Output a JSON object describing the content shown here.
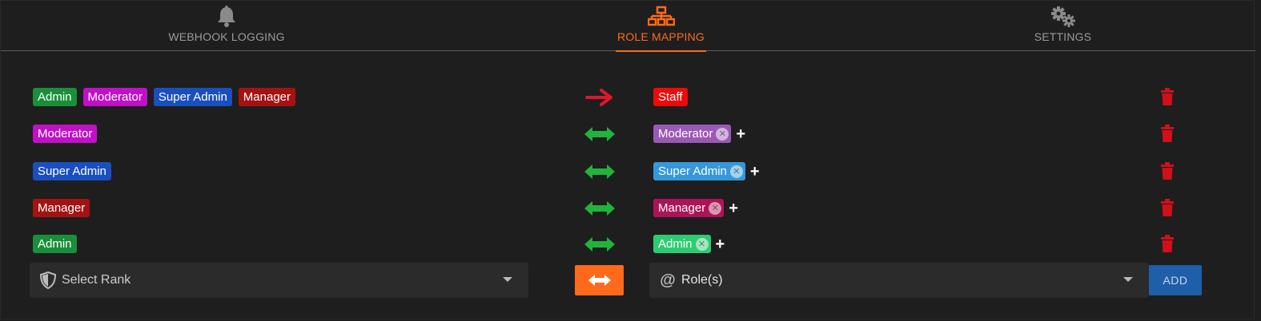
{
  "tabs": [
    {
      "label": "WEBHOOK LOGGING",
      "icon": "bell-icon",
      "active": false
    },
    {
      "label": "ROLE MAPPING",
      "icon": "sitemap-icon",
      "active": true
    },
    {
      "label": "SETTINGS",
      "icon": "gears-icon",
      "active": false
    }
  ],
  "colors": {
    "accent": "#ff6a1a",
    "admin": "#1a8f3a",
    "moderator": "#c010c8",
    "super_admin": "#1a4fbf",
    "manager": "#a51212",
    "staff": "#ee0a0a",
    "role_moderator": "#9b59b6",
    "role_super_admin": "#3498db",
    "role_manager": "#ad1457",
    "role_admin": "#2ecc71",
    "arrow_oneway": "#e0162b",
    "arrow_sync": "#22b33c",
    "trash": "#d0101a"
  },
  "mappings": [
    {
      "ranks": [
        {
          "name": "Admin",
          "color": "#1a8f3a"
        },
        {
          "name": "Moderator",
          "color": "#c010c8"
        },
        {
          "name": "Super Admin",
          "color": "#1a4fbf"
        },
        {
          "name": "Manager",
          "color": "#a51212"
        }
      ],
      "direction": "one-way",
      "roles": [
        {
          "name": "Staff",
          "color": "#ee0a0a",
          "removable": false
        }
      ],
      "addable": false
    },
    {
      "ranks": [
        {
          "name": "Moderator",
          "color": "#c010c8"
        }
      ],
      "direction": "two-way",
      "roles": [
        {
          "name": "Moderator",
          "color": "#9b59b6",
          "removable": true
        }
      ],
      "addable": true
    },
    {
      "ranks": [
        {
          "name": "Super Admin",
          "color": "#1a4fbf"
        }
      ],
      "direction": "two-way",
      "roles": [
        {
          "name": "Super Admin",
          "color": "#3498db",
          "removable": true
        }
      ],
      "addable": true
    },
    {
      "ranks": [
        {
          "name": "Manager",
          "color": "#a51212"
        }
      ],
      "direction": "two-way",
      "roles": [
        {
          "name": "Manager",
          "color": "#ad1457",
          "removable": true
        }
      ],
      "addable": true
    },
    {
      "ranks": [
        {
          "name": "Admin",
          "color": "#1a8f3a"
        }
      ],
      "direction": "two-way",
      "roles": [
        {
          "name": "Admin",
          "color": "#2ecc71",
          "removable": true
        }
      ],
      "addable": true
    }
  ],
  "form": {
    "rank_placeholder": "Select Rank",
    "roles_placeholder": "Role(s)",
    "add_label": "ADD"
  }
}
